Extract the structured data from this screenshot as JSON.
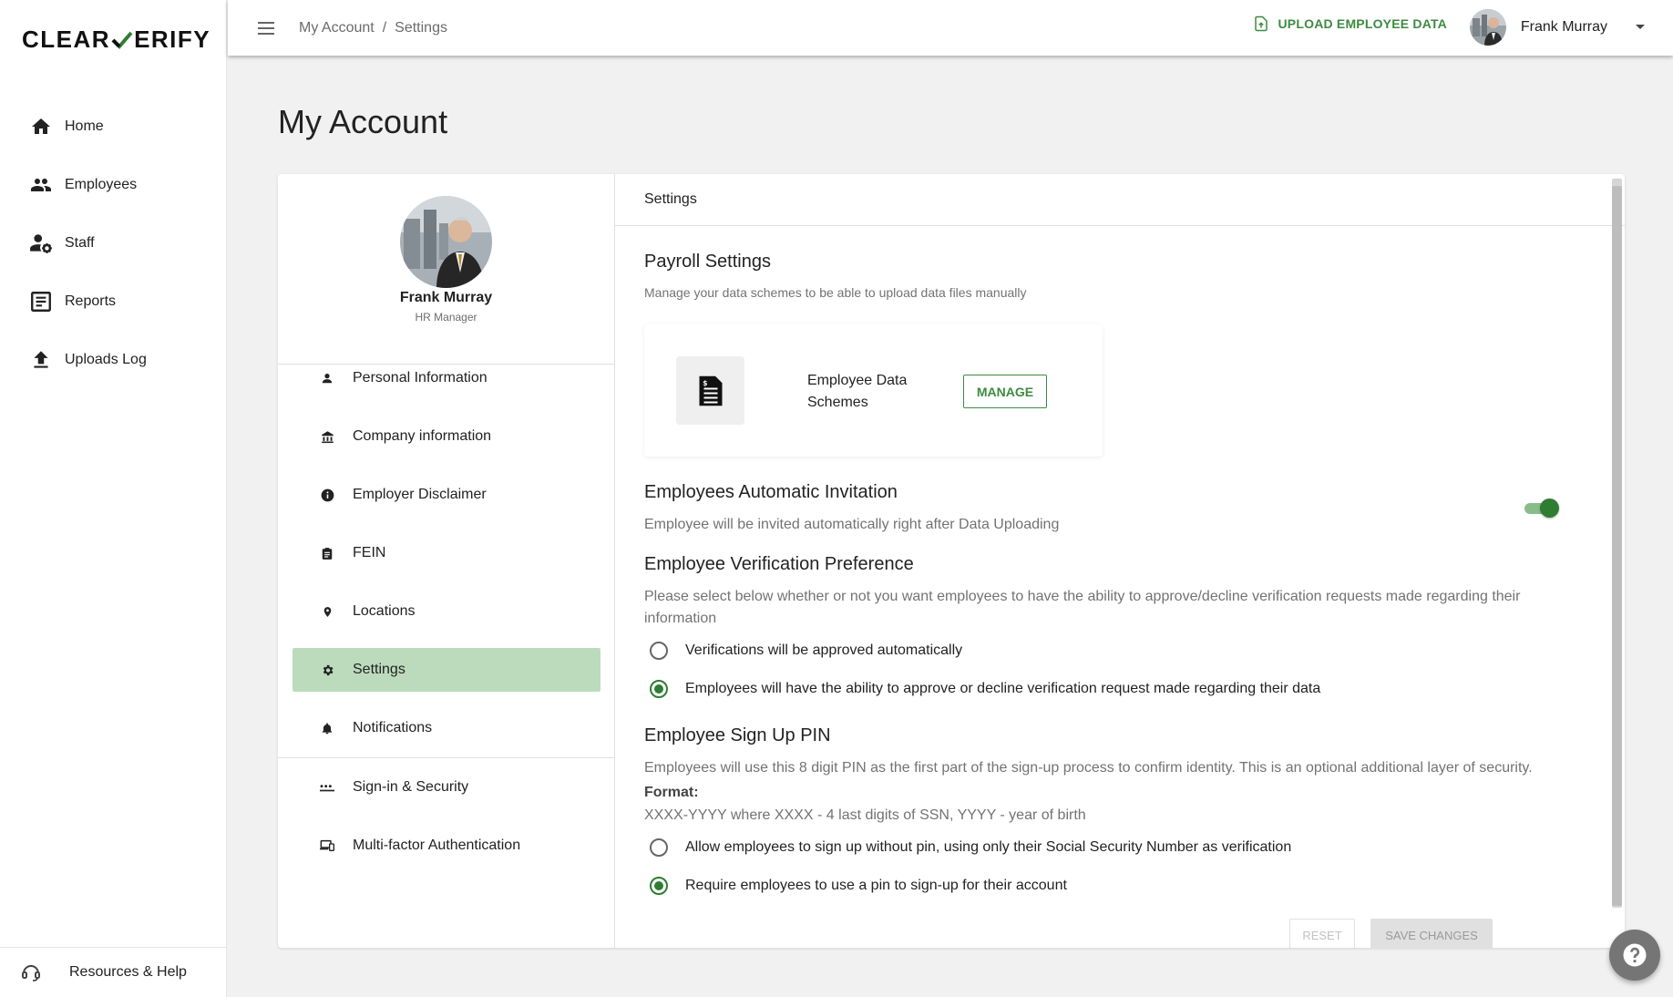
{
  "brand": {
    "logo_left": "CLEAR",
    "logo_right": "ERIFY",
    "accent": "#2e7d32"
  },
  "sidebar": {
    "items": [
      {
        "label": "Home",
        "icon": "home-icon"
      },
      {
        "label": "Employees",
        "icon": "people-icon"
      },
      {
        "label": "Staff",
        "icon": "staff-settings-icon"
      },
      {
        "label": "Reports",
        "icon": "report-icon"
      },
      {
        "label": "Uploads Log",
        "icon": "upload-icon"
      }
    ],
    "footer": {
      "label": "Resources & Help",
      "icon": "support-icon"
    }
  },
  "header": {
    "breadcrumb": [
      "My Account",
      "/",
      "Settings"
    ],
    "upload_label": "UPLOAD EMPLOYEE DATA",
    "user_name": "Frank Murray"
  },
  "page": {
    "title": "My Account"
  },
  "profile": {
    "name": "Frank Murray",
    "role": "HR Manager",
    "menu": [
      {
        "label": "Personal Information",
        "icon": "person-icon"
      },
      {
        "label": "Company information",
        "icon": "bank-icon"
      },
      {
        "label": "Employer Disclaimer",
        "icon": "info-icon"
      },
      {
        "label": "FEIN",
        "icon": "clipboard-icon"
      },
      {
        "label": "Locations",
        "icon": "location-pin-icon"
      },
      {
        "label": "Settings",
        "icon": "gear-icon"
      },
      {
        "label": "Notifications",
        "icon": "bell-icon"
      },
      {
        "label": "Sign-in & Security",
        "icon": "password-icon"
      },
      {
        "label": "Multi-factor Authentication",
        "icon": "devices-icon"
      }
    ]
  },
  "settings": {
    "header": "Settings",
    "payroll": {
      "title": "Payroll Settings",
      "desc": "Manage your data schemes to be able to upload data files manually",
      "scheme_label": "Employee Data Schemes",
      "manage_label": "MANAGE"
    },
    "invitation": {
      "title": "Employees Automatic Invitation",
      "desc": "Employee will be invited automatically right after Data Uploading",
      "enabled": true
    },
    "verification": {
      "title": "Employee Verification Preference",
      "desc": "Please select below whether or not you want employees to have the ability to approve/decline verification requests made regarding their information",
      "options": [
        {
          "label": "Verifications will be approved automatically",
          "selected": false
        },
        {
          "label": "Employees will have the ability to approve or decline verification request made regarding their data",
          "selected": true
        }
      ]
    },
    "pin": {
      "title": "Employee Sign Up PIN",
      "desc": "Employees will use this 8 digit PIN as the first part of the sign-up process to confirm identity. This is an optional additional layer of security.",
      "format_label": "Format:",
      "format_value": "XXXX-YYYY where XXXX - 4 last digits of SSN, YYYY - year of birth",
      "options": [
        {
          "label": "Allow employees to sign up without pin, using only their Social Security Number as verification",
          "selected": false
        },
        {
          "label": "Require employees to use a pin to sign-up for their account",
          "selected": true
        }
      ]
    },
    "reset_label": "RESET",
    "save_label": "SAVE CHANGES"
  }
}
